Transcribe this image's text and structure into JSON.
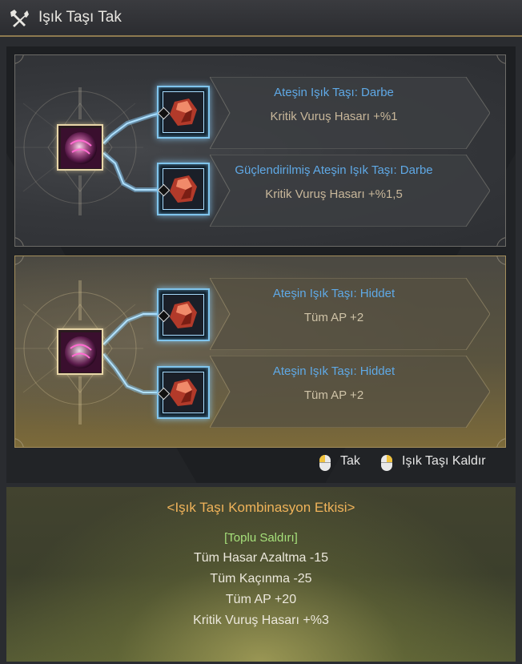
{
  "window": {
    "title": "Işık Taşı Tak",
    "icon": "hammer-wrench-icon"
  },
  "sets": [
    {
      "main_item_icon": "pink-orb-icon",
      "stones": [
        {
          "name": "Ateşin Işık Taşı: Darbe",
          "effect": "Kritik Vuruş Hasarı +%1",
          "icon": "red-crystal-icon"
        },
        {
          "name": "Güçlendirilmiş Ateşin Işık Taşı: Darbe",
          "effect": "Kritik Vuruş Hasarı +%1,5",
          "icon": "red-crystal-icon"
        }
      ]
    },
    {
      "main_item_icon": "pink-orb-icon",
      "stones": [
        {
          "name": "Ateşin Işık Taşı: Hiddet",
          "effect": "Tüm AP +2",
          "icon": "red-crystal-icon"
        },
        {
          "name": "Ateşin Işık Taşı: Hiddet",
          "effect": "Tüm AP +2",
          "icon": "red-crystal-icon"
        }
      ]
    }
  ],
  "legend": {
    "equip_label": "Tak",
    "remove_label": "Işık Taşı Kaldır"
  },
  "combination": {
    "title": "<Işık Taşı Kombinasyon Etkisi>",
    "category": "[Toplu Saldırı]",
    "effects": [
      "Tüm Hasar Azaltma -15",
      "Tüm Kaçınma -25",
      "Tüm AP +20",
      "Kritik Vuruş Hasarı +%3"
    ]
  },
  "colors": {
    "stone_name": "#5fa9e6",
    "stone_effect": "#c8b79a",
    "combo_title": "#f0b35a",
    "combo_category": "#a6e07a",
    "accent_border": "#8d7a4f"
  }
}
